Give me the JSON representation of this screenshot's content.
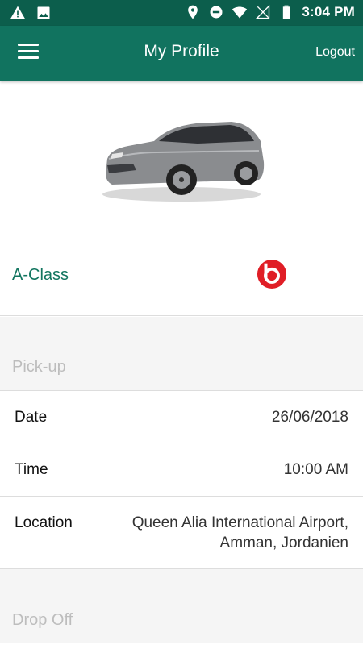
{
  "status_bar": {
    "time": "3:04 PM",
    "left_icons": [
      "warning-icon",
      "image-icon"
    ],
    "right_icons": [
      "location-icon",
      "do-not-disturb-icon",
      "wifi-icon",
      "no-signal-icon",
      "battery-icon"
    ]
  },
  "app_bar": {
    "title": "My Profile",
    "logout_label": "Logout",
    "menu_icon": "hamburger-menu-icon"
  },
  "car": {
    "model": "A-Class",
    "brand_logo": "beats-logo"
  },
  "pickup": {
    "header": "Pick-up",
    "rows": [
      {
        "label": "Date",
        "value": "26/06/2018"
      },
      {
        "label": "Time",
        "value": "10:00 AM"
      },
      {
        "label": "Location",
        "value": "Queen Alia International Airport, Amman, Jordanien"
      }
    ]
  },
  "dropoff": {
    "header": "Drop Off"
  },
  "colors": {
    "status_bar": "#0c5e4c",
    "app_bar": "#11735f",
    "accent_text": "#12755f",
    "section_bg": "#f5f5f5",
    "brand_red": "#e01e26"
  }
}
